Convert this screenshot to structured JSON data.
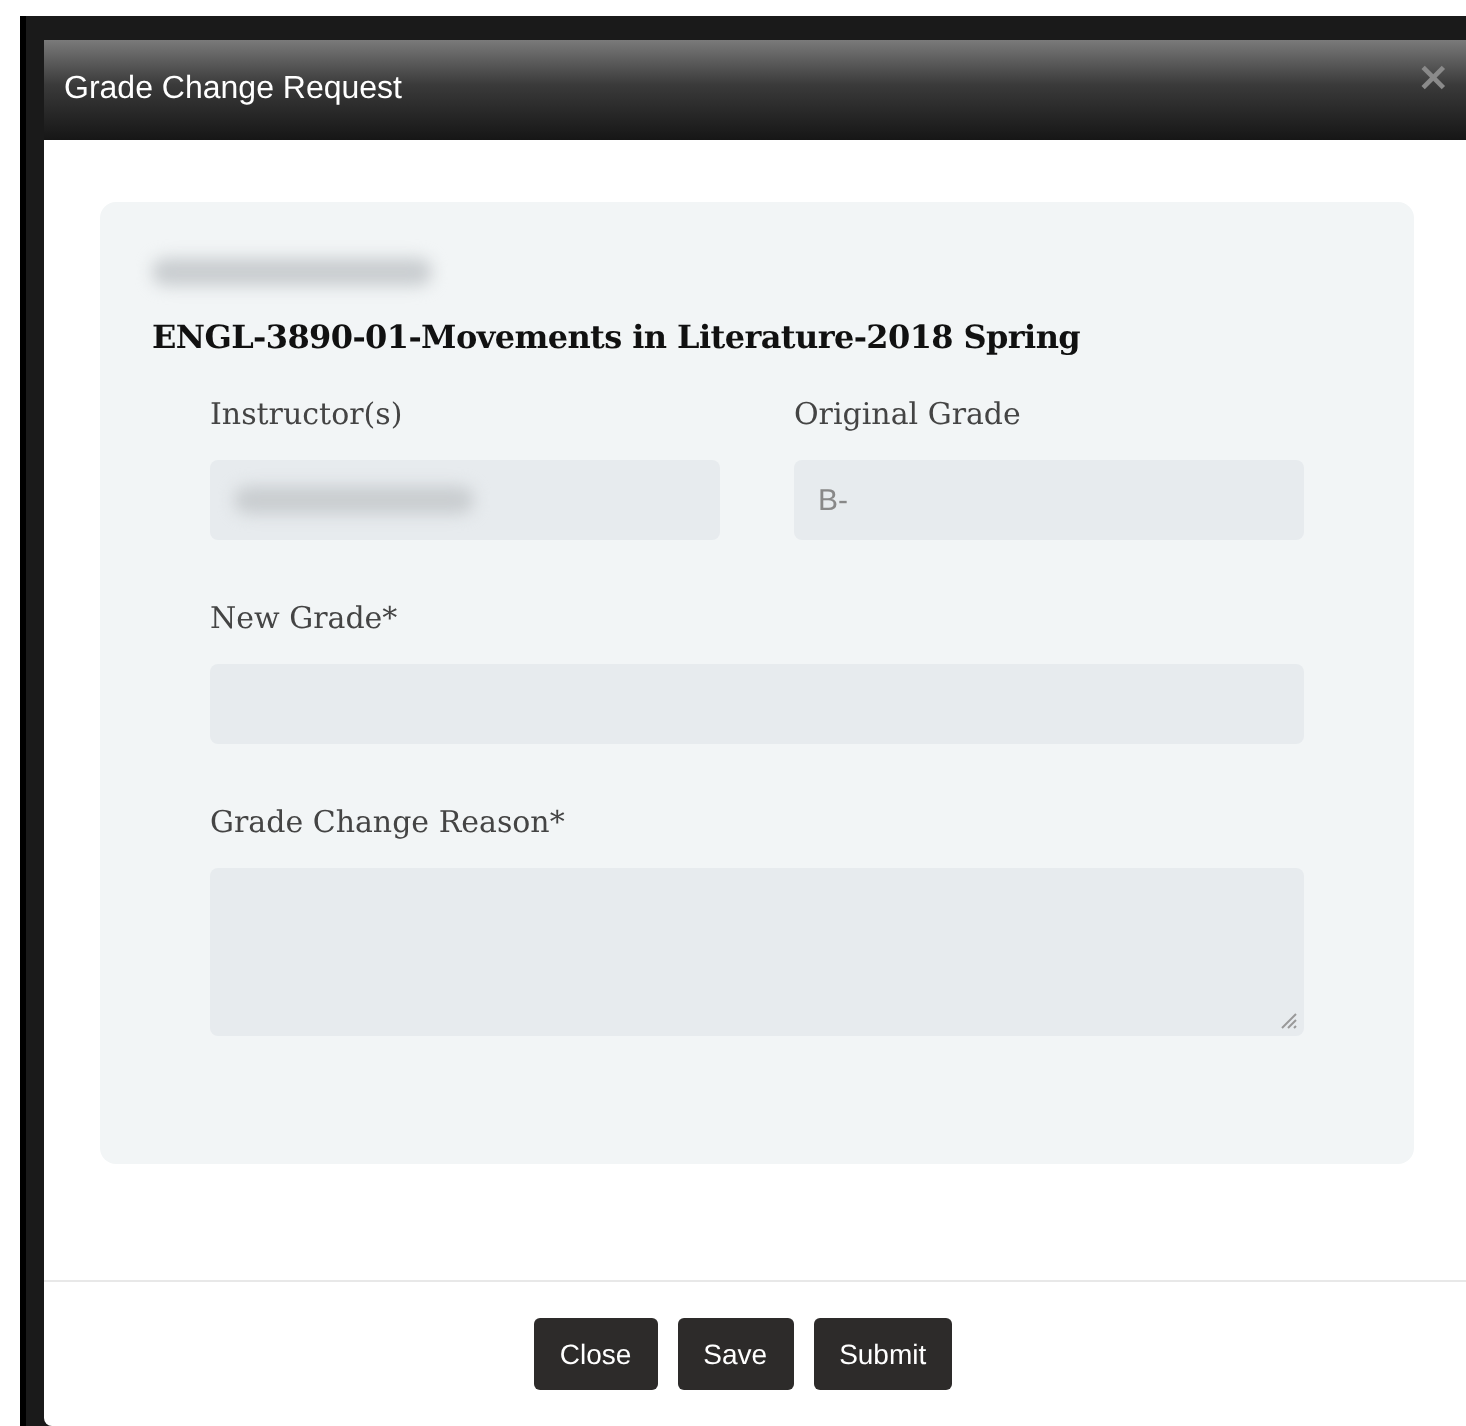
{
  "dialog": {
    "title": "Grade Change Request",
    "close_icon": "×"
  },
  "student": {
    "redacted": true
  },
  "course": "ENGL-3890-01-Movements in Literature-2018 Spring",
  "info_fields": [
    {
      "label": "Instructor(s)",
      "kind": "redacted"
    },
    {
      "label": "Original Grade",
      "kind": "text",
      "value": "B-"
    }
  ],
  "new_grade": {
    "label": "New Grade*"
  },
  "reason": {
    "label": "Grade Change Reason*"
  },
  "buttons": [
    "Close",
    "Save",
    "Submit"
  ]
}
